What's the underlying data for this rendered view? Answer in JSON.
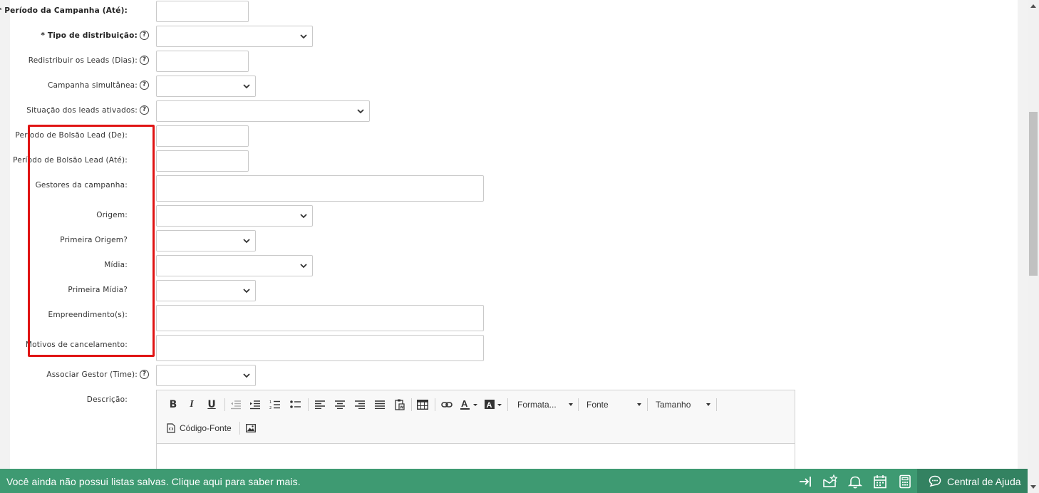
{
  "form": {
    "fields": [
      {
        "label": "* Período da Campanha (Até):"
      },
      {
        "label": "* Tipo de distribuição:"
      },
      {
        "label": "Redistribuir os Leads (Dias):"
      },
      {
        "label": "Campanha simultânea:"
      },
      {
        "label": "Situação dos leads ativados:"
      },
      {
        "label": "Período de Bolsão Lead (De):"
      },
      {
        "label": "Período de Bolsão Lead (Até):"
      },
      {
        "label": "Gestores da campanha:"
      },
      {
        "label": "Origem:"
      },
      {
        "label": "Primeira Origem?"
      },
      {
        "label": "Mídia:"
      },
      {
        "label": "Primeira Mídia?"
      },
      {
        "label": "Empreendimento(s):"
      },
      {
        "label": "Motivos de cancelamento:"
      },
      {
        "label": "Associar Gestor (Time):"
      },
      {
        "label": "Descrição:"
      }
    ],
    "help_glyph": "?",
    "highlight_color": "#e01414"
  },
  "editor": {
    "bold": "B",
    "italic": "I",
    "underline": "U",
    "format_label": "Formata...",
    "font_label": "Fonte",
    "size_label": "Tamanho",
    "source_label": "Código-Fonte"
  },
  "bottombar": {
    "message": "Você ainda não possui listas salvas. Clique aqui para saber mais.",
    "help_center": "Central de Ajuda",
    "bg_color": "#3e9a72",
    "icons": [
      "exit-to-right-icon",
      "mail-star-icon",
      "bell-icon",
      "calendar-icon",
      "calculator-icon",
      "chat-icon"
    ]
  }
}
